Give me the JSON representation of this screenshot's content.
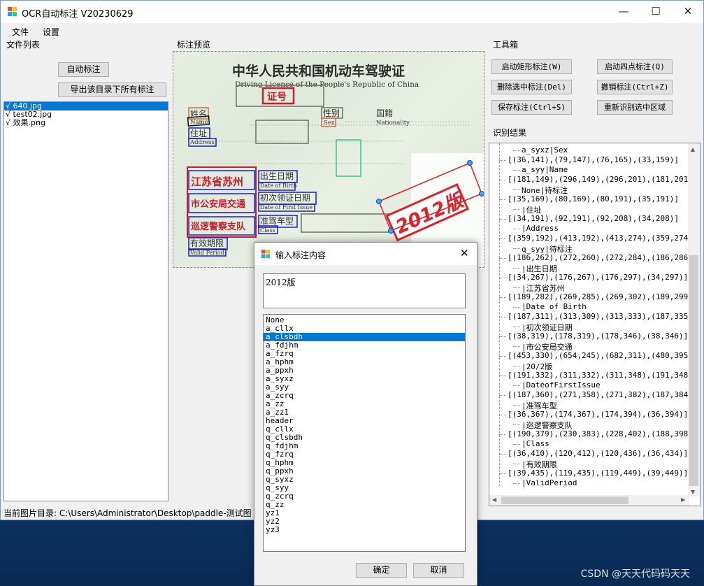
{
  "window": {
    "title": "OCR自动标注 V20230629",
    "minimize": "—",
    "maximize": "☐",
    "close": "✕"
  },
  "menu": {
    "file": "文件",
    "settings": "设置"
  },
  "file_panel": {
    "title": "文件列表",
    "auto_button": "自动标注",
    "export_button": "导出该目录下所有标注",
    "files": [
      {
        "label": "√ 640.jpg",
        "selected": true
      },
      {
        "label": "√ test02.jpg",
        "selected": false
      },
      {
        "label": "√ 效果.png",
        "selected": false
      }
    ]
  },
  "preview": {
    "title": "标注预览",
    "license_title_cn": "中华人民共和国机动车驾驶证",
    "license_title_en": "Driving License of the People's Republic of China",
    "cert_no": "证号",
    "name_cn": "姓名",
    "name_en": "Name",
    "sex_cn": "性别",
    "sex_en": "Sex",
    "nationality_cn": "国籍",
    "nationality_en": "Nationality",
    "address_cn": "住址",
    "address_en": "Address",
    "dob_cn": "出生日期",
    "dob_en": "Date of Birth",
    "first_issue_cn": "初次领证日期",
    "first_issue_en": "Date of First Issue",
    "class_cn": "准驾车型",
    "class_en": "Class",
    "valid_cn": "有效期限",
    "valid_en": "Valid Period",
    "stamp_lines": [
      "江苏省苏州",
      "市公安局交通",
      "巡逻警察支队"
    ],
    "overlay_text": "2012版"
  },
  "toolbox": {
    "title": "工具箱",
    "buttons": {
      "rect": "启动矩形标注(W)",
      "quad": "启动四点标注(Q)",
      "delete": "删除选中标注(Del)",
      "undo": "撤销标注(Ctrl+Z)",
      "save": "保存标注(Ctrl+S)",
      "reocr": "重新识别选中区域"
    }
  },
  "results": {
    "title": "识别结果",
    "lines": [
      {
        "indent": 1,
        "text": "a_syxz|Sex"
      },
      {
        "indent": 0,
        "text": "[(36,141),(79,147),(76,165),(33,159)]"
      },
      {
        "indent": 1,
        "text": "a_syy|Name"
      },
      {
        "indent": 0,
        "text": "[(181,149),(296,149),(296,201),(181,201)]"
      },
      {
        "indent": 1,
        "text": "None|待标注"
      },
      {
        "indent": 0,
        "text": "[(35,169),(80,169),(80,191),(35,191)]"
      },
      {
        "indent": 1,
        "text": "|住址"
      },
      {
        "indent": 0,
        "text": "[(34,191),(92,191),(92,208),(34,208)]"
      },
      {
        "indent": 1,
        "text": "|Address"
      },
      {
        "indent": 0,
        "text": "[(359,192),(413,192),(413,274),(359,274)]"
      },
      {
        "indent": 1,
        "text": "q_syy|待标注"
      },
      {
        "indent": 0,
        "text": "[(186,262),(272,260),(272,284),(186,286)]"
      },
      {
        "indent": 1,
        "text": "|出生日期"
      },
      {
        "indent": 0,
        "text": "[(34,267),(176,267),(176,297),(34,297)]"
      },
      {
        "indent": 1,
        "text": "|江苏省苏州"
      },
      {
        "indent": 0,
        "text": "[(189,282),(269,285),(269,302),(189,299)]"
      },
      {
        "indent": 1,
        "text": "|Date of Birth"
      },
      {
        "indent": 0,
        "text": "[(187,311),(313,309),(313,333),(187,335)]"
      },
      {
        "indent": 1,
        "text": "|初次领证日期"
      },
      {
        "indent": 0,
        "text": "[(38,319),(178,319),(178,346),(38,346)]"
      },
      {
        "indent": 1,
        "text": "|市公安局交通"
      },
      {
        "indent": 0,
        "text": "[(453,330),(654,245),(682,311),(480,395)]"
      },
      {
        "indent": 1,
        "text": "|20/2版"
      },
      {
        "indent": 0,
        "text": "[(191,332),(311,332),(311,348),(191,348)]"
      },
      {
        "indent": 1,
        "text": "|DateofFirstIssue"
      },
      {
        "indent": 0,
        "text": "[(187,360),(271,358),(271,382),(187,384)]"
      },
      {
        "indent": 1,
        "text": "|准驾车型"
      },
      {
        "indent": 0,
        "text": "[(36,367),(174,367),(174,394),(36,394)]"
      },
      {
        "indent": 1,
        "text": "|巡逻警察支队"
      },
      {
        "indent": 0,
        "text": "[(190,379),(230,383),(228,402),(188,398)]"
      },
      {
        "indent": 1,
        "text": "|Class"
      },
      {
        "indent": 0,
        "text": "[(36,410),(120,412),(120,436),(36,434)]"
      },
      {
        "indent": 1,
        "text": "|有效期限"
      },
      {
        "indent": 0,
        "text": "[(39,435),(119,435),(119,449),(39,449)]"
      },
      {
        "indent": 1,
        "text": "|ValidPeriod"
      }
    ]
  },
  "status": {
    "label": "当前图片目录:",
    "path": "C:\\Users\\Administrator\\Desktop\\paddle-测试图"
  },
  "dialog": {
    "title": "输入标注内容",
    "close": "✕",
    "input_value": "2012版",
    "options": [
      "None",
      "a_cllx",
      "a_clsbdh",
      "a_fdjhm",
      "a_fzrq",
      "a_hphm",
      "a_ppxh",
      "a_syxz",
      "a_syy",
      "a_zcrq",
      "a_zz",
      "a_zz1",
      "header",
      "q_cllx",
      "q_clsbdh",
      "q_fdjhm",
      "q_fzrq",
      "q_hphm",
      "q_ppxh",
      "q_syxz",
      "q_syy",
      "q_zcrq",
      "q_zz",
      "yz1",
      "yz2",
      "yz3"
    ],
    "selected_option": "a_clsbdh",
    "ok": "确定",
    "cancel": "取消"
  },
  "watermark": "CSDN @天天代码码天天",
  "colors": {
    "accent": "#0078d7",
    "box_blue": "#1a1ad0",
    "box_red": "#c81e2e",
    "box_green": "#2ecc8a",
    "box_gray": "#6f6f5a"
  }
}
